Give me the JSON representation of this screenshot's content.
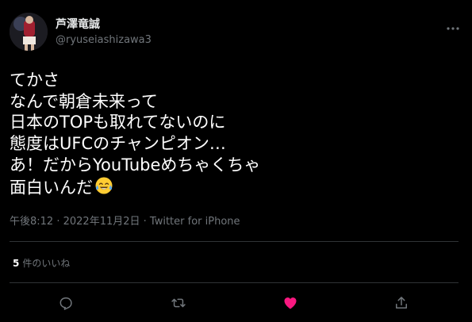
{
  "author": {
    "display_name": "芦澤竜誠",
    "handle": "@ryuseiashizawa3"
  },
  "tweet": {
    "lines": [
      "てかさ",
      "なんで朝倉未来って",
      "日本のTOPも取れてないのに",
      "態度はUFCのチャンピオン…",
      "あ！だからYouTubeめちゃくちゃ",
      "面白いんだ"
    ],
    "emoji": "face-with-tears-of-joy"
  },
  "meta": {
    "time": "午後8:12",
    "separator": " · ",
    "date": "2022年11月2日",
    "source": "Twitter for iPhone"
  },
  "stats": {
    "likes_count": "5",
    "likes_label": "件のいいね"
  },
  "actions": {
    "reply_icon": "reply-icon",
    "retweet_icon": "retweet-icon",
    "like_icon": "heart-icon",
    "share_icon": "share-icon"
  },
  "colors": {
    "background": "#000000",
    "text": "#ffffff",
    "secondary": "#71767b",
    "divider": "#2f3336",
    "like": "#f91880"
  }
}
